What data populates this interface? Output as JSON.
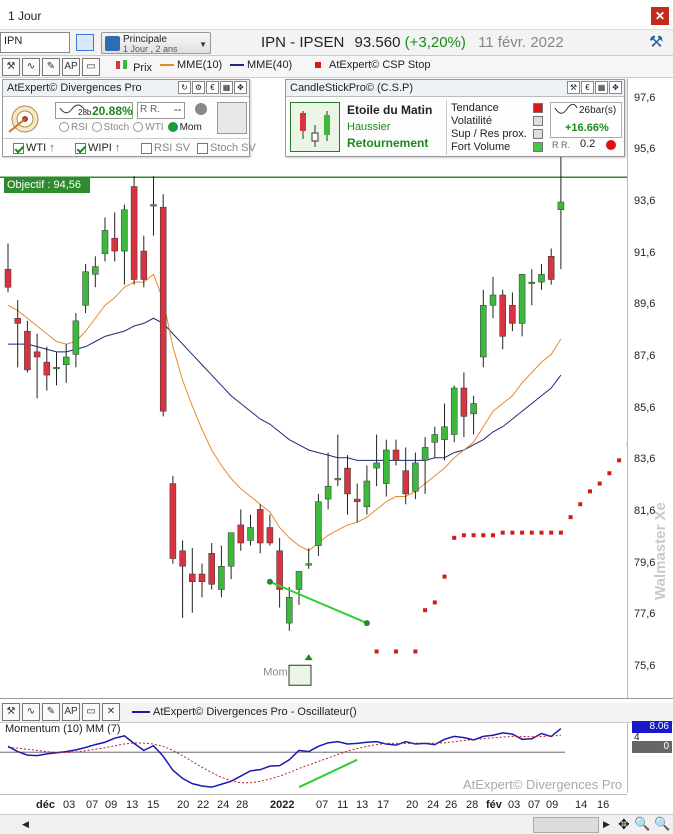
{
  "window": {
    "title": "1 Jour"
  },
  "toolbar": {
    "symbol": "IPN",
    "layout_line1": "Principale",
    "layout_line2": "1 Jour , 2 ans",
    "instrument": "IPN - IPSEN",
    "price": "93.560",
    "change": "(+3,20%)",
    "date": "11 févr. 2022"
  },
  "legend": {
    "price": "Prix",
    "ema10": "MME(10)",
    "ema40": "MME(40)",
    "csp_stop": "AtExpert© CSP Stop",
    "colors": {
      "price_up": "#3cb93c",
      "price_down": "#d8343f",
      "ema10": "#e8892c",
      "ema40": "#1f2a7a",
      "stop": "#d61a1a"
    }
  },
  "divergences_panel": {
    "title": "AtExpert© Divergences Pro",
    "period": "28b",
    "pct": "20.88%",
    "rvalue": "--",
    "radios": [
      "RSI",
      "Stoch",
      "WTI",
      "Mom"
    ],
    "selected": "Mom",
    "checks": [
      {
        "label": "WTI",
        "on": true
      },
      {
        "label": "WIPI",
        "on": true
      },
      {
        "label": "RSI SV",
        "on": false
      },
      {
        "label": "Stoch SV",
        "on": false
      }
    ]
  },
  "csp_panel": {
    "title": "CandleStickPro© (C.S.P)",
    "pattern": "Etoile du Matin",
    "direction": "Haussier",
    "signal": "Retournement",
    "metrics": [
      "Tendance",
      "Volatilité",
      "Sup / Res prox.",
      "Fort Volume"
    ],
    "bars": "26bar(s)",
    "pct": "+16.66%",
    "value": "0.2"
  },
  "objective_label": "Objectif : 94,56",
  "mom_label": "Mom",
  "y_axis": [
    "97,6",
    "95,6",
    "93,6",
    "91,6",
    "89,6",
    "87,6",
    "85,6",
    "83,6",
    "81,6",
    "79,6",
    "77,6",
    "75,6"
  ],
  "watermark": "Walmaster Xe",
  "oscillator": {
    "title": "AtExpert© Divergences Pro - Oscillateur()",
    "subtitle": "Momentum (10) MM (7)",
    "value1": "8.06",
    "value2": "4",
    "value3": "0",
    "watermark": "AtExpert© Divergences Pro"
  },
  "x_axis": [
    "déc",
    "03",
    "07",
    "09",
    "13",
    "15",
    "20",
    "22",
    "24",
    "28",
    "2022",
    "07",
    "11",
    "13",
    "17",
    "20",
    "24",
    "26",
    "28",
    "fév",
    "03",
    "07",
    "09",
    "14",
    "16"
  ],
  "chart_data": {
    "type": "candlestick",
    "title": "IPN - IPSEN",
    "ylim": [
      74.4,
      98.4
    ],
    "candles": [
      {
        "o": 91.0,
        "h": 92.0,
        "l": 90.1,
        "c": 90.3
      },
      {
        "o": 89.1,
        "h": 89.8,
        "l": 87.2,
        "c": 88.9
      },
      {
        "o": 88.6,
        "h": 89.0,
        "l": 87.0,
        "c": 87.1
      },
      {
        "o": 87.8,
        "h": 88.5,
        "l": 86.0,
        "c": 87.6
      },
      {
        "o": 87.4,
        "h": 88.0,
        "l": 86.3,
        "c": 86.9
      },
      {
        "o": 87.2,
        "h": 87.8,
        "l": 86.5,
        "c": 87.2
      },
      {
        "o": 87.3,
        "h": 88.1,
        "l": 86.6,
        "c": 87.6
      },
      {
        "o": 87.7,
        "h": 89.3,
        "l": 87.2,
        "c": 89.0
      },
      {
        "o": 89.6,
        "h": 91.2,
        "l": 89.3,
        "c": 90.9
      },
      {
        "o": 90.8,
        "h": 91.5,
        "l": 90.3,
        "c": 91.1
      },
      {
        "o": 91.6,
        "h": 93.0,
        "l": 91.3,
        "c": 92.5
      },
      {
        "o": 92.2,
        "h": 93.2,
        "l": 91.3,
        "c": 91.7
      },
      {
        "o": 91.7,
        "h": 93.5,
        "l": 90.4,
        "c": 93.3
      },
      {
        "o": 94.2,
        "h": 94.6,
        "l": 90.4,
        "c": 90.6
      },
      {
        "o": 91.7,
        "h": 92.3,
        "l": 90.3,
        "c": 90.6
      },
      {
        "o": 93.5,
        "h": 94.6,
        "l": 92.3,
        "c": 93.5
      },
      {
        "o": 93.4,
        "h": 93.9,
        "l": 85.3,
        "c": 85.5
      },
      {
        "o": 82.7,
        "h": 83.0,
        "l": 79.6,
        "c": 79.8
      },
      {
        "o": 80.1,
        "h": 80.5,
        "l": 77.5,
        "c": 79.5
      },
      {
        "o": 79.2,
        "h": 80.2,
        "l": 77.7,
        "c": 78.9
      },
      {
        "o": 79.2,
        "h": 79.6,
        "l": 78.3,
        "c": 78.9
      },
      {
        "o": 80.0,
        "h": 80.4,
        "l": 78.6,
        "c": 78.8
      },
      {
        "o": 78.6,
        "h": 80.3,
        "l": 78.3,
        "c": 79.5
      },
      {
        "o": 79.5,
        "h": 80.8,
        "l": 79.0,
        "c": 80.8
      },
      {
        "o": 81.1,
        "h": 81.7,
        "l": 80.1,
        "c": 80.4
      },
      {
        "o": 80.5,
        "h": 81.5,
        "l": 80.3,
        "c": 81.0
      },
      {
        "o": 81.7,
        "h": 81.9,
        "l": 80.0,
        "c": 80.4
      },
      {
        "o": 81.0,
        "h": 81.5,
        "l": 80.3,
        "c": 80.4
      },
      {
        "o": 80.1,
        "h": 80.6,
        "l": 77.9,
        "c": 78.6
      },
      {
        "o": 77.3,
        "h": 78.7,
        "l": 77.0,
        "c": 78.3
      },
      {
        "o": 78.6,
        "h": 79.1,
        "l": 78.0,
        "c": 79.3
      },
      {
        "o": 79.6,
        "h": 80.2,
        "l": 79.4,
        "c": 79.6
      },
      {
        "o": 80.3,
        "h": 82.3,
        "l": 79.9,
        "c": 82.0
      },
      {
        "o": 82.1,
        "h": 83.9,
        "l": 81.7,
        "c": 82.6
      },
      {
        "o": 82.9,
        "h": 84.6,
        "l": 82.6,
        "c": 82.9
      },
      {
        "o": 83.3,
        "h": 83.8,
        "l": 81.5,
        "c": 82.3
      },
      {
        "o": 82.1,
        "h": 82.7,
        "l": 81.2,
        "c": 82.0
      },
      {
        "o": 81.8,
        "h": 83.4,
        "l": 81.5,
        "c": 82.8
      },
      {
        "o": 83.3,
        "h": 84.6,
        "l": 82.6,
        "c": 83.5
      },
      {
        "o": 82.7,
        "h": 84.4,
        "l": 82.2,
        "c": 84.0
      },
      {
        "o": 84.0,
        "h": 84.4,
        "l": 83.4,
        "c": 83.6
      },
      {
        "o": 83.2,
        "h": 84.1,
        "l": 81.9,
        "c": 82.3
      },
      {
        "o": 82.4,
        "h": 83.9,
        "l": 82.1,
        "c": 83.5
      },
      {
        "o": 83.6,
        "h": 84.5,
        "l": 82.3,
        "c": 84.1
      },
      {
        "o": 84.3,
        "h": 84.9,
        "l": 83.7,
        "c": 84.6
      },
      {
        "o": 84.4,
        "h": 85.8,
        "l": 83.6,
        "c": 84.9
      },
      {
        "o": 84.6,
        "h": 86.5,
        "l": 84.3,
        "c": 86.4
      },
      {
        "o": 86.4,
        "h": 87.0,
        "l": 84.5,
        "c": 85.3
      },
      {
        "o": 85.4,
        "h": 86.1,
        "l": 84.6,
        "c": 85.8
      },
      {
        "o": 87.6,
        "h": 90.2,
        "l": 87.2,
        "c": 89.6
      },
      {
        "o": 89.6,
        "h": 90.7,
        "l": 89.1,
        "c": 90.0
      },
      {
        "o": 90.0,
        "h": 90.2,
        "l": 87.9,
        "c": 88.4
      },
      {
        "o": 89.6,
        "h": 90.1,
        "l": 88.6,
        "c": 88.9
      },
      {
        "o": 88.9,
        "h": 90.8,
        "l": 88.4,
        "c": 90.8
      },
      {
        "o": 90.5,
        "h": 91.0,
        "l": 89.6,
        "c": 90.5
      },
      {
        "o": 90.5,
        "h": 91.2,
        "l": 90.2,
        "c": 90.8
      },
      {
        "o": 91.5,
        "h": 91.8,
        "l": 90.4,
        "c": 90.6
      },
      {
        "o": 93.3,
        "h": 95.8,
        "l": 91.0,
        "c": 93.6
      }
    ],
    "ema10": [
      89.6,
      89.4,
      89.1,
      88.8,
      88.5,
      88.2,
      88.1,
      88.2,
      88.6,
      89.1,
      89.6,
      89.9,
      90.3,
      90.5,
      90.5,
      90.8,
      89.8,
      88.0,
      86.7,
      85.7,
      84.8,
      84.0,
      83.4,
      82.9,
      82.5,
      82.2,
      81.9,
      81.6,
      81.0,
      80.6,
      80.3,
      80.1,
      80.4,
      80.7,
      80.9,
      81.1,
      81.2,
      81.4,
      81.7,
      82.0,
      82.2,
      82.2,
      82.4,
      82.7,
      83.0,
      83.3,
      83.7,
      84.0,
      84.3,
      84.9,
      85.5,
      85.8,
      86.1,
      86.6,
      87.0,
      87.4,
      87.7,
      88.3
    ],
    "ema40": [
      88.1,
      88.1,
      88.1,
      88.0,
      87.9,
      87.8,
      87.8,
      87.9,
      88.0,
      88.2,
      88.4,
      88.5,
      88.6,
      88.8,
      88.9,
      89.1,
      88.9,
      88.5,
      88.1,
      87.7,
      87.3,
      86.9,
      86.5,
      86.1,
      85.8,
      85.5,
      85.2,
      85.0,
      84.7,
      84.4,
      84.2,
      84.0,
      83.9,
      83.8,
      83.7,
      83.7,
      83.6,
      83.6,
      83.6,
      83.6,
      83.6,
      83.6,
      83.6,
      83.6,
      83.7,
      83.7,
      83.9,
      84.0,
      84.2,
      84.4,
      84.7,
      84.9,
      85.2,
      85.5,
      85.8,
      86.1,
      86.4,
      86.9
    ],
    "csp_stop": [
      [
        38,
        76.2
      ],
      [
        40,
        76.2
      ],
      [
        42,
        76.2
      ],
      [
        43,
        77.8
      ],
      [
        44,
        78.1
      ],
      [
        45,
        79.1
      ],
      [
        46,
        80.6
      ],
      [
        47,
        80.7
      ],
      [
        48,
        80.7
      ],
      [
        49,
        80.7
      ],
      [
        50,
        80.7
      ],
      [
        51,
        80.8
      ],
      [
        52,
        80.8
      ],
      [
        53,
        80.8
      ],
      [
        54,
        80.8
      ],
      [
        55,
        80.8
      ],
      [
        56,
        80.8
      ],
      [
        57,
        80.8
      ],
      [
        58,
        81.4
      ],
      [
        59,
        81.9
      ],
      [
        60,
        82.4
      ],
      [
        61,
        82.7
      ],
      [
        62,
        83.1
      ],
      [
        63,
        83.6
      ],
      [
        64,
        84.2
      ],
      [
        65,
        86.0
      ],
      [
        66,
        87.6
      ],
      [
        67,
        87.6
      ],
      [
        68,
        87.6
      ]
    ],
    "momentum": [
      2.0,
      0.2,
      -1.0,
      -1.2,
      -0.6,
      -0.2,
      0.2,
      0.8,
      1.6,
      2.6,
      3.4,
      4.8,
      5.6,
      3.0,
      0.6,
      2.2,
      -1.4,
      -6.2,
      -9.0,
      -10.8,
      -11.6,
      -12.0,
      -11.0,
      -10.0,
      -8.2,
      -6.4,
      -6.0,
      -4.8,
      -4.6,
      -2.6,
      0.6,
      0.2,
      2.0,
      3.2,
      3.6,
      2.8,
      3.0,
      3.4,
      3.6,
      2.8,
      2.4,
      3.6,
      2.8,
      3.0,
      2.6,
      4.4,
      5.4,
      5.0,
      4.2,
      5.4,
      5.8,
      6.6,
      6.2,
      4.4,
      4.6,
      6.4,
      5.4,
      8.1
    ],
    "momentum_ma": [
      1.6,
      1.4,
      1.0,
      0.6,
      0.2,
      -0.2,
      -0.1,
      0.1,
      0.5,
      1.0,
      1.5,
      2.2,
      2.8,
      3.2,
      3.1,
      2.8,
      2.0,
      0.6,
      -1.2,
      -3.2,
      -5.2,
      -7.0,
      -8.6,
      -9.8,
      -10.5,
      -10.5,
      -10.0,
      -9.2,
      -8.2,
      -7.0,
      -5.6,
      -4.4,
      -3.2,
      -2.0,
      -0.8,
      0.4,
      1.2,
      2.0,
      2.6,
      3.0,
      3.0,
      3.0,
      3.1,
      3.1,
      3.1,
      3.2,
      3.6,
      4.0,
      4.3,
      4.6,
      4.9,
      5.2,
      5.4,
      5.4,
      5.3,
      5.4,
      5.5,
      5.8
    ],
    "osc_ylim": [
      -14,
      10
    ],
    "divergence_price": [
      [
        27,
        78.9
      ],
      [
        37,
        77.3
      ]
    ],
    "divergence_osc": [
      [
        30,
        -12.0
      ],
      [
        36,
        -2.6
      ]
    ]
  }
}
